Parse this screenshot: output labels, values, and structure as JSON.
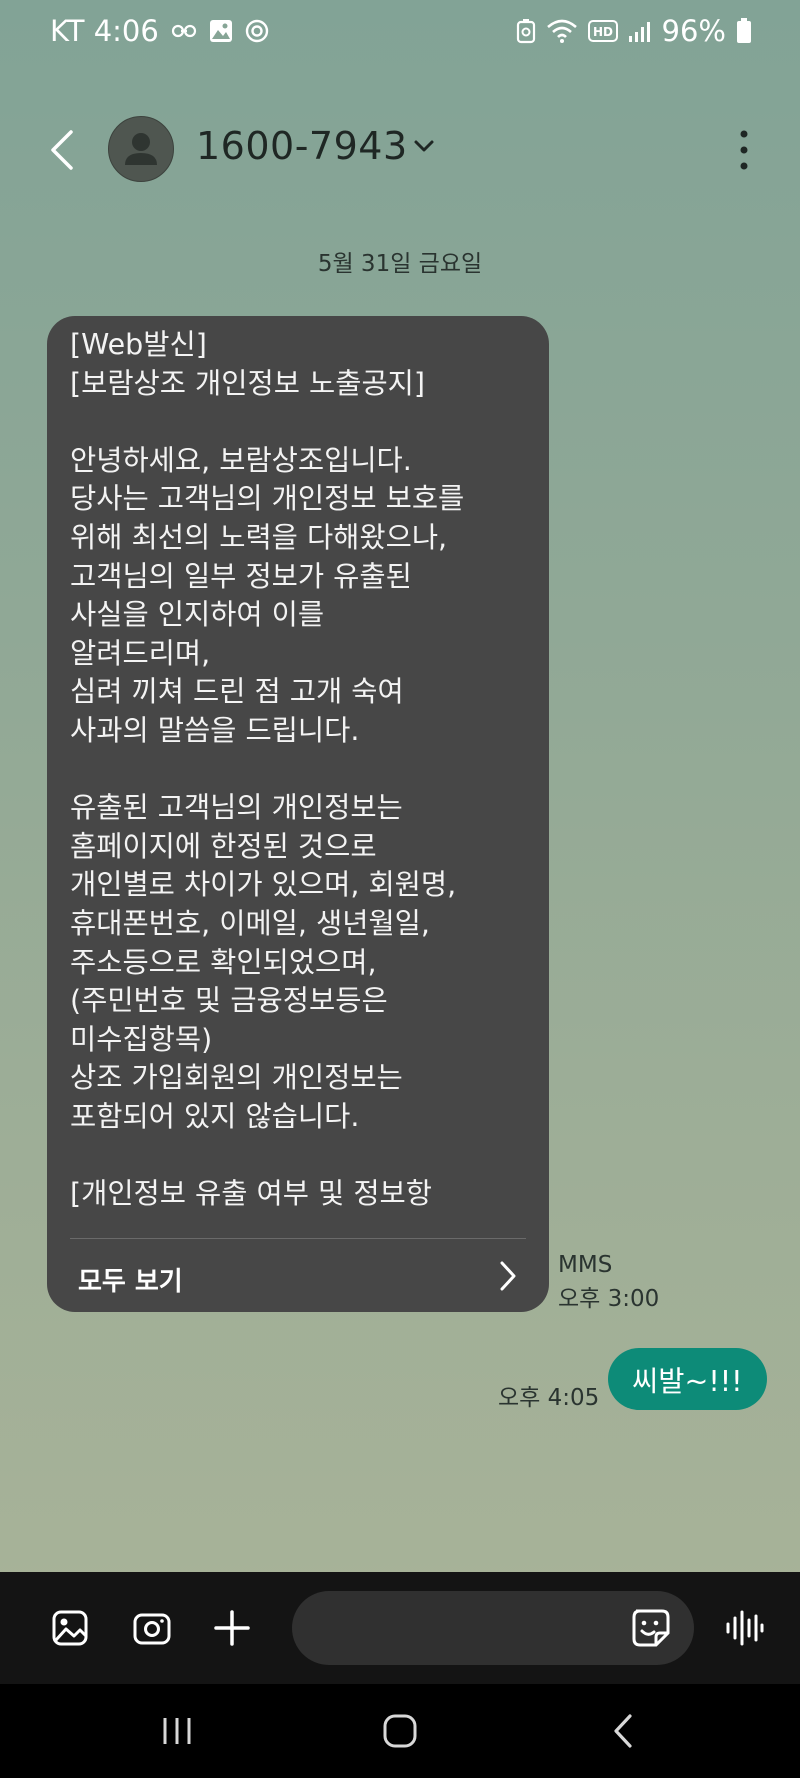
{
  "status_bar": {
    "carrier_time": "KT 4:06",
    "battery": "96%",
    "network_badge": "HD"
  },
  "header": {
    "contact": "1600-7943"
  },
  "conversation": {
    "date": "5월 31일 금요일",
    "incoming": {
      "text": "[Web발신]\n[보람상조 개인정보 노출공지]\n\n안녕하세요, 보람상조입니다.\n당사는 고객님의 개인정보 보호를\n위해 최선의 노력을 다해왔으나,\n고객님의 일부 정보가 유출된\n사실을 인지하여 이를\n알려드리며,\n심려 끼쳐 드린 점 고개 숙여\n사과의 말씀을 드립니다.\n\n유출된 고객님의 개인정보는\n홈페이지에 한정된 것으로\n개인별로 차이가 있으며, 회원명,\n휴대폰번호, 이메일, 생년월일,\n주소등으로 확인되었으며,\n(주민번호 및 금융정보등은\n미수집항목)\n상조 가입회원의 개인정보는\n포함되어 있지 않습니다.\n\n[개인정보 유출 여부 및 정보항",
      "view_all_label": "모두 보기",
      "type": "MMS",
      "time": "오후 3:00"
    },
    "outgoing": {
      "text": "씨발~!!!",
      "time": "오후 4:05"
    }
  },
  "compose": {
    "placeholder": ""
  },
  "colors": {
    "incoming_bubble": "#474747",
    "outgoing_bubble": "#0d8b78",
    "compose_bg": "#141414"
  },
  "icons": [
    "chain-icon",
    "image-icon",
    "target-icon",
    "recycle-icon",
    "wifi-icon",
    "hd-icon",
    "signal-icon",
    "battery-icon",
    "back-icon",
    "avatar-icon",
    "chevron-down-icon",
    "more-vert-icon",
    "chevron-right-icon",
    "gallery-icon",
    "camera-icon",
    "plus-icon",
    "sticker-icon",
    "voice-icon",
    "recent-apps-icon",
    "home-icon",
    "nav-back-icon"
  ]
}
